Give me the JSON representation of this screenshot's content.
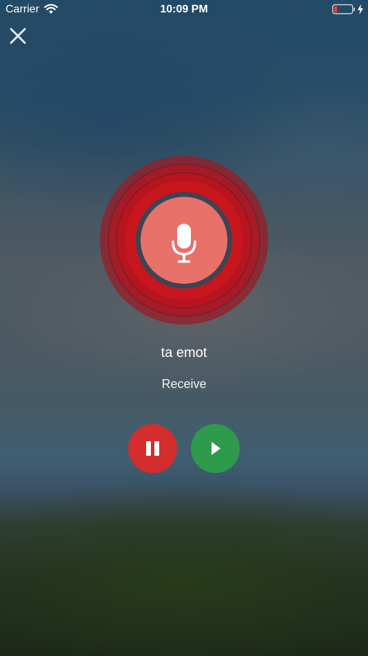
{
  "status_bar": {
    "carrier": "Carrier",
    "time": "10:09 PM",
    "wifi_icon": "wifi-icon",
    "battery_icon": "battery-low-icon",
    "charging_icon": "charging-bolt-icon"
  },
  "toolbar": {
    "close_icon": "close-icon"
  },
  "recorder": {
    "mic_icon": "microphone-icon",
    "accent_color": "#c8161e",
    "mic_fill_color": "#e8716a"
  },
  "contact": {
    "name": "ta emot",
    "status": "Receive"
  },
  "controls": {
    "pause_icon": "pause-icon",
    "pause_color": "#d42d2d",
    "play_icon": "play-icon",
    "play_color": "#2e9a4b"
  }
}
